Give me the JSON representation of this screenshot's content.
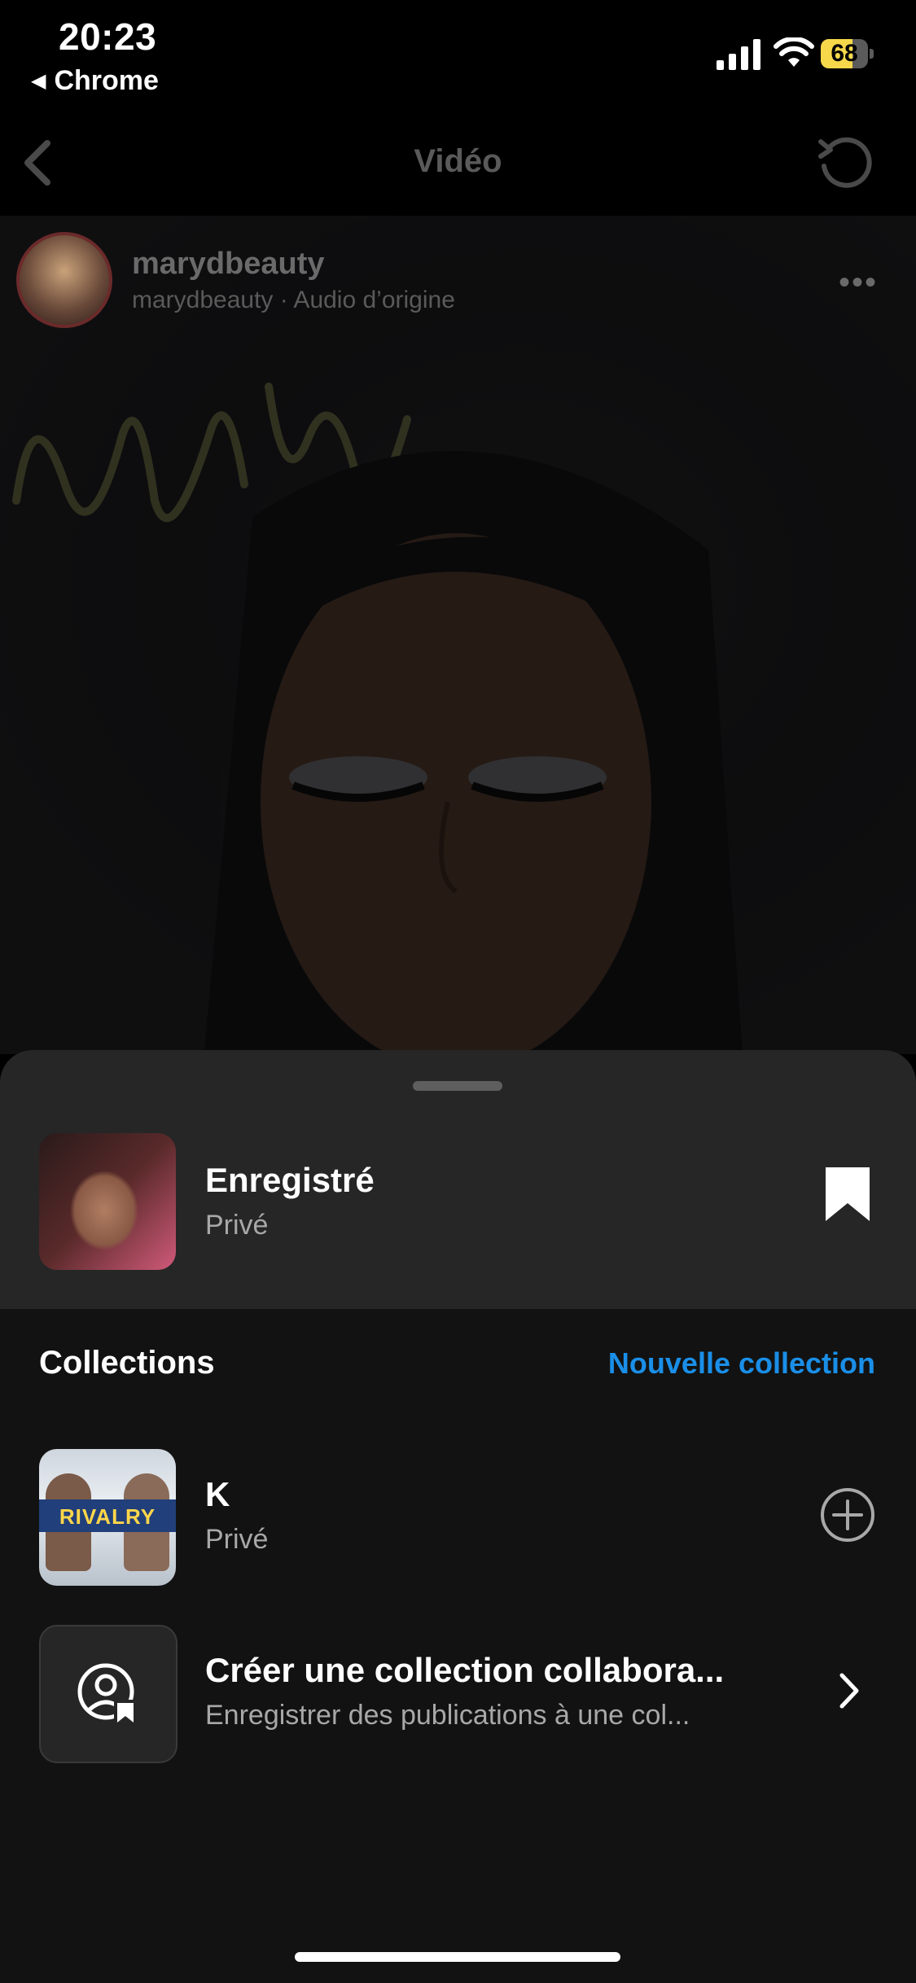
{
  "status_bar": {
    "time": "20:23",
    "back_app": "Chrome",
    "battery_level": "68",
    "battery_fraction": 0.68,
    "battery_color": "#f6d84a"
  },
  "nav": {
    "title": "Vidéo"
  },
  "video": {
    "author_name": "marydbeauty",
    "author_sub": "marydbeauty · Audio d’origine",
    "more_icon": "more-horizontal-icon"
  },
  "sheet": {
    "saved": {
      "title": "Enregistré",
      "subtitle": "Privé",
      "icon": "bookmark-filled-icon"
    },
    "collections_heading": "Collections",
    "new_collection_label": "Nouvelle collection",
    "accent_color": "#1a8fe8",
    "collections": [
      {
        "title": "K",
        "subtitle": "Privé",
        "thumb_text": "RIVALRY",
        "icon": "add-circle-icon"
      }
    ],
    "collab": {
      "title": "Créer une collection collabora...",
      "subtitle": "Enregistrer des publications à une col...",
      "icon": "collab-collection-icon"
    }
  }
}
